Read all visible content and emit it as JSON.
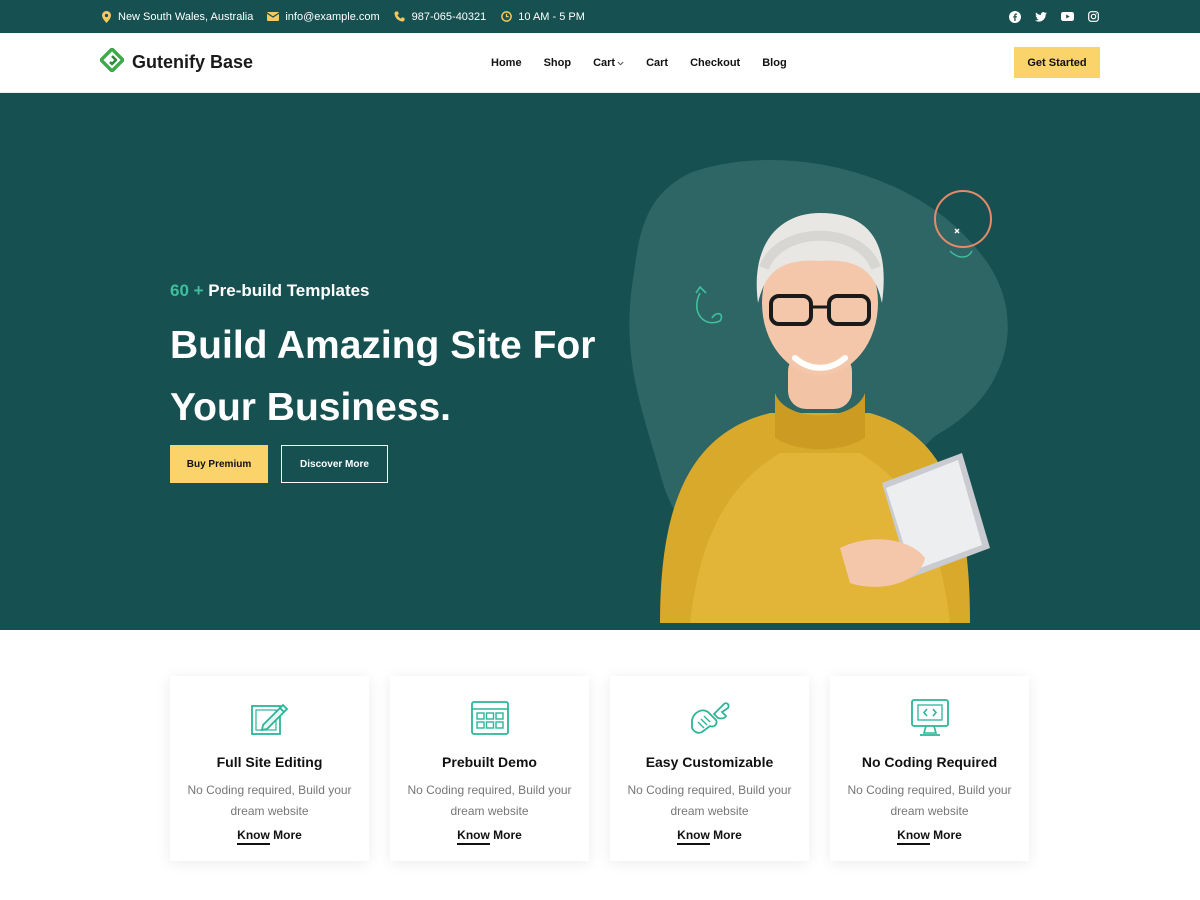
{
  "topbar": {
    "location": "New South Wales, Australia",
    "email": "info@example.com",
    "phone": "987-065-40321",
    "hours": "10 AM - 5 PM",
    "social": [
      "facebook-icon",
      "twitter-icon",
      "youtube-icon",
      "instagram-icon"
    ]
  },
  "header": {
    "brand": "Gutenify Base",
    "nav": [
      {
        "label": "Home"
      },
      {
        "label": "Shop"
      },
      {
        "label": "Cart",
        "has_dropdown": true
      },
      {
        "label": "Cart"
      },
      {
        "label": "Checkout"
      },
      {
        "label": "Blog"
      }
    ],
    "cta": "Get Started"
  },
  "hero": {
    "kicker_accent": "60 +",
    "kicker_text": "Pre-build Templates",
    "title": "Build Amazing Site For Your Business.",
    "primary_button": "Buy Premium",
    "secondary_button": "Discover More"
  },
  "features": [
    {
      "icon": "edit-icon",
      "title": "Full Site Editing",
      "desc": "No Coding required, Build your dream website",
      "link_prefix": "Know",
      "link_suffix": " More"
    },
    {
      "icon": "grid-window-icon",
      "title": "Prebuilt Demo",
      "desc": "No Coding required, Build your dream website",
      "link_prefix": "Know",
      "link_suffix": " More"
    },
    {
      "icon": "wrench-hand-icon",
      "title": "Easy Customizable",
      "desc": "No Coding required, Build your dream website",
      "link_prefix": "Know",
      "link_suffix": " More"
    },
    {
      "icon": "code-monitor-icon",
      "title": "No Coding Required",
      "desc": "No Coding required, Build your dream website",
      "link_prefix": "Know",
      "link_suffix": " More"
    }
  ],
  "colors": {
    "primary": "#175050",
    "accent": "#fbd36b",
    "teal_accent": "#3fbf9d"
  }
}
